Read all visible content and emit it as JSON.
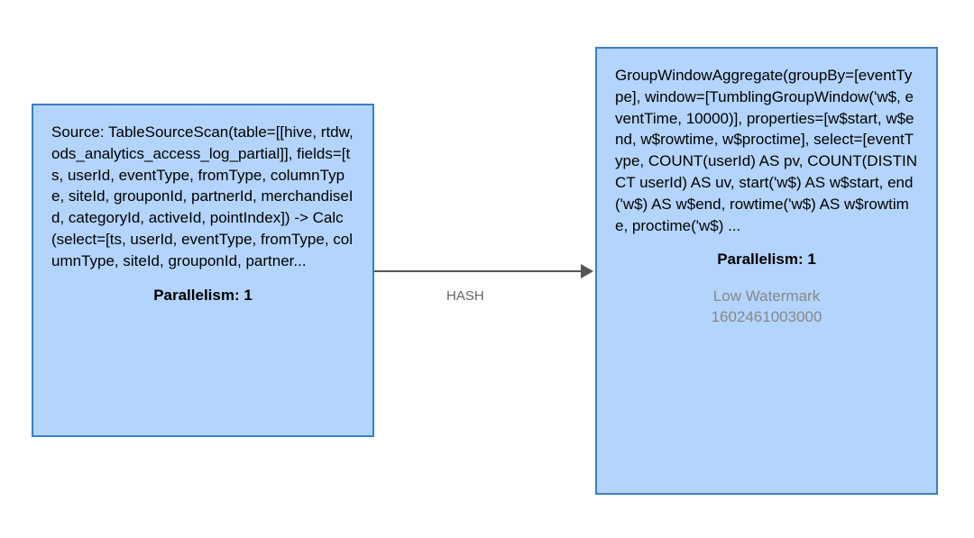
{
  "nodes": {
    "source": {
      "text": "Source: TableSourceScan(table=[[hive, rtdw, ods_analytics_access_log_partial]], fields=[ts, userId, eventType, fromType, columnType, siteId, grouponId, partnerId, merchandiseId, categoryId, activeId, pointIndex]) -> Calc(select=[ts, userId, eventType, fromType, columnType, siteId, grouponId, partner...",
      "parallelism_label": "Parallelism: 1"
    },
    "aggregate": {
      "text": "GroupWindowAggregate(groupBy=[eventType], window=[TumblingGroupWindow('w$, eventTime, 10000)], properties=[w$start, w$end, w$rowtime, w$proctime], select=[eventType, COUNT(userId) AS pv, COUNT(DISTINCT userId) AS uv, start('w$) AS w$start, end('w$) AS w$end, rowtime('w$) AS w$rowtime, proctime('w$) ...",
      "parallelism_label": "Parallelism: 1",
      "watermark_label": "Low Watermark",
      "watermark_value": "1602461003000"
    }
  },
  "edge": {
    "label": "HASH"
  }
}
